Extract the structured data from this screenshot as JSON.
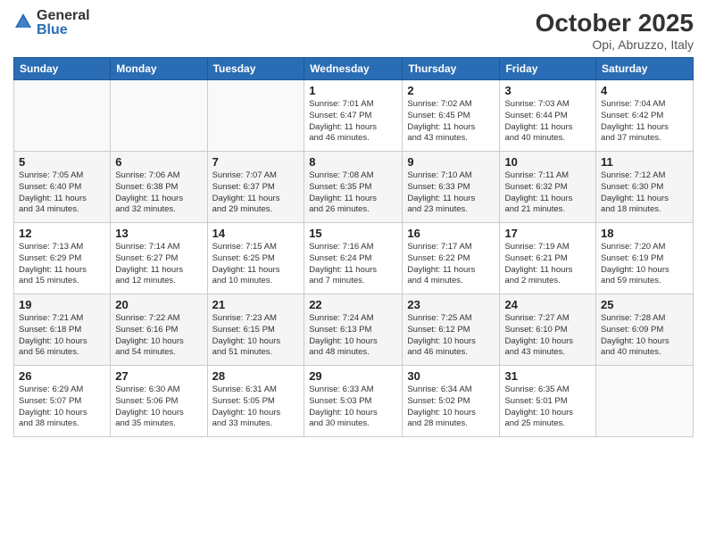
{
  "header": {
    "logo_general": "General",
    "logo_blue": "Blue",
    "month": "October 2025",
    "location": "Opi, Abruzzo, Italy"
  },
  "weekdays": [
    "Sunday",
    "Monday",
    "Tuesday",
    "Wednesday",
    "Thursday",
    "Friday",
    "Saturday"
  ],
  "weeks": [
    [
      {
        "num": "",
        "info": ""
      },
      {
        "num": "",
        "info": ""
      },
      {
        "num": "",
        "info": ""
      },
      {
        "num": "1",
        "info": "Sunrise: 7:01 AM\nSunset: 6:47 PM\nDaylight: 11 hours\nand 46 minutes."
      },
      {
        "num": "2",
        "info": "Sunrise: 7:02 AM\nSunset: 6:45 PM\nDaylight: 11 hours\nand 43 minutes."
      },
      {
        "num": "3",
        "info": "Sunrise: 7:03 AM\nSunset: 6:44 PM\nDaylight: 11 hours\nand 40 minutes."
      },
      {
        "num": "4",
        "info": "Sunrise: 7:04 AM\nSunset: 6:42 PM\nDaylight: 11 hours\nand 37 minutes."
      }
    ],
    [
      {
        "num": "5",
        "info": "Sunrise: 7:05 AM\nSunset: 6:40 PM\nDaylight: 11 hours\nand 34 minutes."
      },
      {
        "num": "6",
        "info": "Sunrise: 7:06 AM\nSunset: 6:38 PM\nDaylight: 11 hours\nand 32 minutes."
      },
      {
        "num": "7",
        "info": "Sunrise: 7:07 AM\nSunset: 6:37 PM\nDaylight: 11 hours\nand 29 minutes."
      },
      {
        "num": "8",
        "info": "Sunrise: 7:08 AM\nSunset: 6:35 PM\nDaylight: 11 hours\nand 26 minutes."
      },
      {
        "num": "9",
        "info": "Sunrise: 7:10 AM\nSunset: 6:33 PM\nDaylight: 11 hours\nand 23 minutes."
      },
      {
        "num": "10",
        "info": "Sunrise: 7:11 AM\nSunset: 6:32 PM\nDaylight: 11 hours\nand 21 minutes."
      },
      {
        "num": "11",
        "info": "Sunrise: 7:12 AM\nSunset: 6:30 PM\nDaylight: 11 hours\nand 18 minutes."
      }
    ],
    [
      {
        "num": "12",
        "info": "Sunrise: 7:13 AM\nSunset: 6:29 PM\nDaylight: 11 hours\nand 15 minutes."
      },
      {
        "num": "13",
        "info": "Sunrise: 7:14 AM\nSunset: 6:27 PM\nDaylight: 11 hours\nand 12 minutes."
      },
      {
        "num": "14",
        "info": "Sunrise: 7:15 AM\nSunset: 6:25 PM\nDaylight: 11 hours\nand 10 minutes."
      },
      {
        "num": "15",
        "info": "Sunrise: 7:16 AM\nSunset: 6:24 PM\nDaylight: 11 hours\nand 7 minutes."
      },
      {
        "num": "16",
        "info": "Sunrise: 7:17 AM\nSunset: 6:22 PM\nDaylight: 11 hours\nand 4 minutes."
      },
      {
        "num": "17",
        "info": "Sunrise: 7:19 AM\nSunset: 6:21 PM\nDaylight: 11 hours\nand 2 minutes."
      },
      {
        "num": "18",
        "info": "Sunrise: 7:20 AM\nSunset: 6:19 PM\nDaylight: 10 hours\nand 59 minutes."
      }
    ],
    [
      {
        "num": "19",
        "info": "Sunrise: 7:21 AM\nSunset: 6:18 PM\nDaylight: 10 hours\nand 56 minutes."
      },
      {
        "num": "20",
        "info": "Sunrise: 7:22 AM\nSunset: 6:16 PM\nDaylight: 10 hours\nand 54 minutes."
      },
      {
        "num": "21",
        "info": "Sunrise: 7:23 AM\nSunset: 6:15 PM\nDaylight: 10 hours\nand 51 minutes."
      },
      {
        "num": "22",
        "info": "Sunrise: 7:24 AM\nSunset: 6:13 PM\nDaylight: 10 hours\nand 48 minutes."
      },
      {
        "num": "23",
        "info": "Sunrise: 7:25 AM\nSunset: 6:12 PM\nDaylight: 10 hours\nand 46 minutes."
      },
      {
        "num": "24",
        "info": "Sunrise: 7:27 AM\nSunset: 6:10 PM\nDaylight: 10 hours\nand 43 minutes."
      },
      {
        "num": "25",
        "info": "Sunrise: 7:28 AM\nSunset: 6:09 PM\nDaylight: 10 hours\nand 40 minutes."
      }
    ],
    [
      {
        "num": "26",
        "info": "Sunrise: 6:29 AM\nSunset: 5:07 PM\nDaylight: 10 hours\nand 38 minutes."
      },
      {
        "num": "27",
        "info": "Sunrise: 6:30 AM\nSunset: 5:06 PM\nDaylight: 10 hours\nand 35 minutes."
      },
      {
        "num": "28",
        "info": "Sunrise: 6:31 AM\nSunset: 5:05 PM\nDaylight: 10 hours\nand 33 minutes."
      },
      {
        "num": "29",
        "info": "Sunrise: 6:33 AM\nSunset: 5:03 PM\nDaylight: 10 hours\nand 30 minutes."
      },
      {
        "num": "30",
        "info": "Sunrise: 6:34 AM\nSunset: 5:02 PM\nDaylight: 10 hours\nand 28 minutes."
      },
      {
        "num": "31",
        "info": "Sunrise: 6:35 AM\nSunset: 5:01 PM\nDaylight: 10 hours\nand 25 minutes."
      },
      {
        "num": "",
        "info": ""
      }
    ]
  ]
}
